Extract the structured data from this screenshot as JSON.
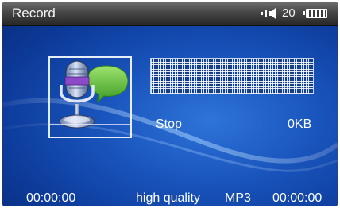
{
  "status_bar": {
    "title": "Record",
    "volume": "20",
    "speaker_icon": "speaker-icon",
    "battery_icon": "battery-icon"
  },
  "recorder": {
    "state": "Stop",
    "file_size": "0KB",
    "mic_icon": "microphone-icon"
  },
  "footer": {
    "elapsed_time": "00:00:00",
    "quality": "high quality",
    "format": "MP3",
    "total_time": "00:00:00"
  },
  "colors": {
    "background": "#1a56be",
    "status_bar": "#3a3a3a",
    "text": "#ffffff"
  }
}
